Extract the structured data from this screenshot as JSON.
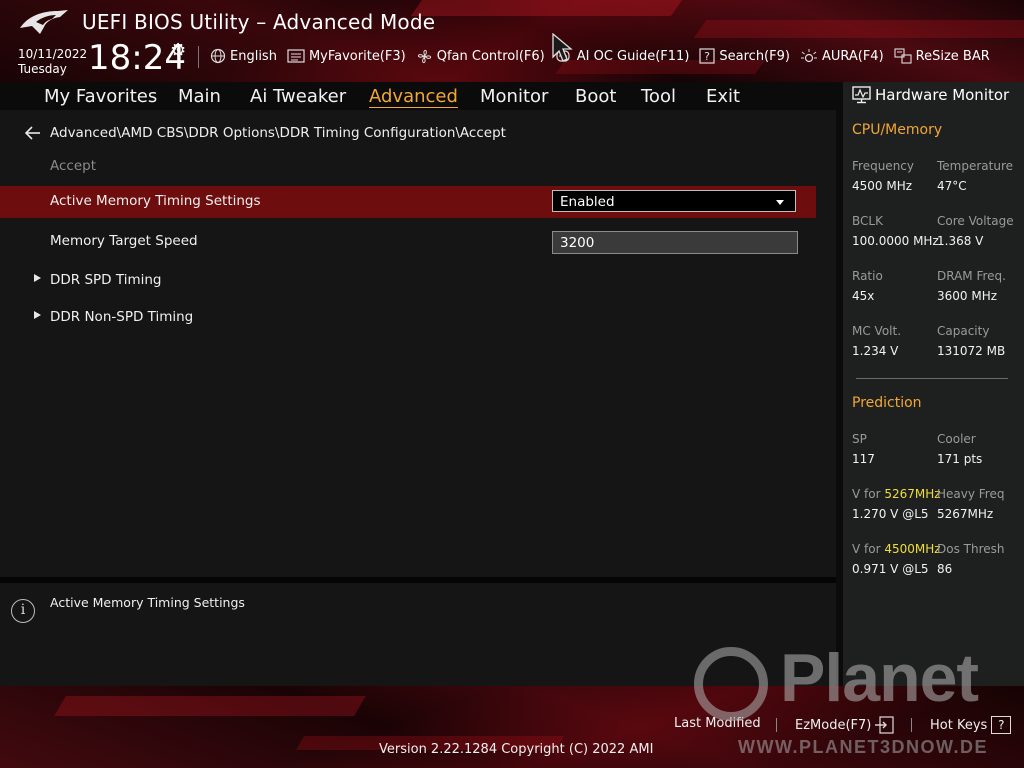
{
  "app": {
    "title": "UEFI BIOS Utility – Advanced Mode"
  },
  "datetime": {
    "date": "10/11/2022",
    "day": "Tuesday",
    "time": "18:24"
  },
  "toolbar": {
    "items": [
      {
        "label": "English",
        "icon": "globe-icon"
      },
      {
        "label": "MyFavorite(F3)",
        "icon": "favorite-icon"
      },
      {
        "label": "Qfan Control(F6)",
        "icon": "fan-icon"
      },
      {
        "label": "AI OC Guide(F11)",
        "icon": "ai-oc-icon"
      },
      {
        "label": "Search(F9)",
        "icon": "search-help-icon"
      },
      {
        "label": "AURA(F4)",
        "icon": "aura-light-icon"
      },
      {
        "label": "ReSize BAR",
        "icon": "resize-bar-icon"
      }
    ]
  },
  "nav": {
    "tabs": [
      "My Favorites",
      "Main",
      "Ai Tweaker",
      "Advanced",
      "Monitor",
      "Boot",
      "Tool",
      "Exit"
    ],
    "active": "Advanced"
  },
  "main": {
    "breadcrumb": "Advanced\\AMD CBS\\DDR Options\\DDR Timing Configuration\\Accept",
    "section_label": "Accept",
    "settings": [
      {
        "label": "Active Memory Timing Settings",
        "type": "dropdown",
        "value": "Enabled",
        "selected": true
      },
      {
        "label": "Memory Target Speed",
        "type": "text",
        "value": "3200"
      }
    ],
    "submenus": [
      "DDR SPD Timing",
      "DDR Non-SPD Timing"
    ]
  },
  "info": {
    "text": "Active Memory Timing Settings",
    "icon": "info-icon"
  },
  "hardware_monitor": {
    "title": "Hardware Monitor",
    "cpu_memory": {
      "heading": "CPU/Memory",
      "items": [
        {
          "label": "Frequency",
          "value": "4500 MHz"
        },
        {
          "label": "Temperature",
          "value": "47°C"
        },
        {
          "label": "BCLK",
          "value": "100.0000 MHz"
        },
        {
          "label": "Core Voltage",
          "value": "1.368 V"
        },
        {
          "label": "Ratio",
          "value": "45x"
        },
        {
          "label": "DRAM Freq.",
          "value": "3600 MHz"
        },
        {
          "label": "MC Volt.",
          "value": "1.234 V"
        },
        {
          "label": "Capacity",
          "value": "131072 MB"
        }
      ]
    },
    "prediction": {
      "heading": "Prediction",
      "sp_label": "SP",
      "sp_value": "117",
      "cooler_label": "Cooler",
      "cooler_value": "171 pts",
      "v1_prefix": "V for ",
      "v1_freq": "5267MHz",
      "v1_value": "1.270 V @L5",
      "heavy_label": "Heavy Freq",
      "heavy_value": "5267MHz",
      "v2_prefix": "V for ",
      "v2_freq": "4500MHz",
      "v2_value": "0.971 V @L5",
      "dos_label": "Dos Thresh",
      "dos_value": "86"
    }
  },
  "footer": {
    "last_modified": "Last Modified",
    "ezmode": "EzMode(F7)",
    "hotkeys": "Hot Keys",
    "hotkeys_key": "?",
    "version": "Version 2.22.1284 Copyright (C) 2022 AMI"
  },
  "watermark": {
    "word": "Planet",
    "url": "WWW.PLANET3DNOW.DE"
  },
  "colors": {
    "accent": "#f3a734",
    "highlight": "#f0dd3c",
    "selected_row": "#6e0d0d"
  }
}
